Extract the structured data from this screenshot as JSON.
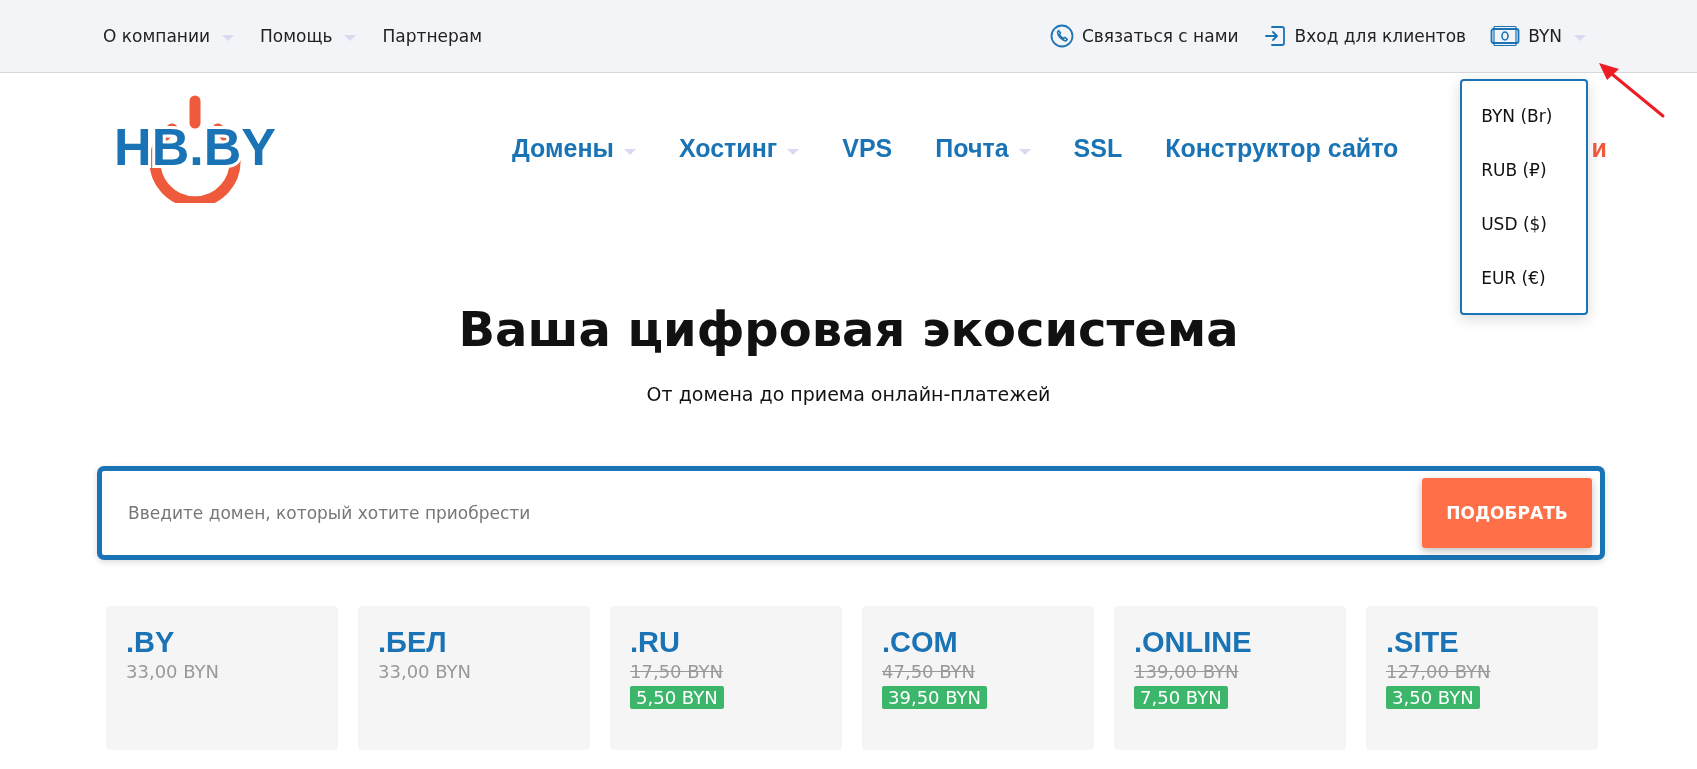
{
  "top_bar": {
    "left_links": [
      {
        "label": "О компании",
        "has_menu": true
      },
      {
        "label": "Помощь",
        "has_menu": true
      },
      {
        "label": "Партнерам",
        "has_menu": false
      }
    ],
    "right_links": [
      {
        "label": "Связаться с нами",
        "kind": "phone"
      },
      {
        "label": "Вход для клиентов",
        "kind": "login"
      }
    ],
    "currency": {
      "label": "BYN",
      "expanded": true,
      "options": [
        "BYN (Br)",
        "RUB (₽)",
        "USD ($)",
        "EUR (€)"
      ]
    }
  },
  "logo": {
    "text": "HB.BY"
  },
  "nav": [
    {
      "label": "Домены",
      "has_menu": true,
      "highlight": false
    },
    {
      "label": "Хостинг",
      "has_menu": true,
      "highlight": false
    },
    {
      "label": "VPS",
      "has_menu": false,
      "highlight": false
    },
    {
      "label": "Почта",
      "has_menu": true,
      "highlight": false
    },
    {
      "label": "SSL",
      "has_menu": false,
      "highlight": false
    },
    {
      "label": "Конструктор сайто",
      "has_menu": false,
      "highlight": false
    },
    {
      "label": "и",
      "has_menu": false,
      "highlight": true
    }
  ],
  "hero": {
    "title": "Ваша цифровая экосистема",
    "subtitle": "От домена до приема онлайн-платежей"
  },
  "search": {
    "placeholder": "Введите домен, который хотите приобрести",
    "button": "ПОДОБРАТЬ"
  },
  "domains": [
    {
      "zone": ".BY",
      "price": "33,00 BYN"
    },
    {
      "zone": ".БЕЛ",
      "price": "33,00 BYN"
    },
    {
      "zone": ".RU",
      "old_price": "17,50 BYN",
      "price": "5,50 BYN"
    },
    {
      "zone": ".COM",
      "old_price": "47,50 BYN",
      "price": "39,50 BYN"
    },
    {
      "zone": ".ONLINE",
      "old_price": "139,00 BYN",
      "price": "7,50 BYN"
    },
    {
      "zone": ".SITE",
      "old_price": "127,00 BYN",
      "price": "3,50 BYN"
    }
  ],
  "annotation": {
    "kind": "arrow"
  }
}
